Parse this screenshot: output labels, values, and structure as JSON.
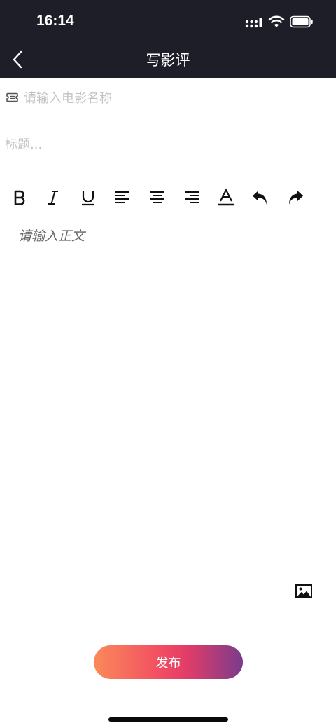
{
  "status_bar": {
    "time": "16:14"
  },
  "nav": {
    "title": "写影评"
  },
  "form": {
    "movie_placeholder": "请输入电影名称",
    "title_placeholder": "标题...",
    "body_placeholder": "请输入正文"
  },
  "toolbar": {
    "items": [
      {
        "name": "bold",
        "icon": "bold-icon"
      },
      {
        "name": "italic",
        "icon": "italic-icon"
      },
      {
        "name": "underline",
        "icon": "underline-icon"
      },
      {
        "name": "align-left",
        "icon": "align-left-icon"
      },
      {
        "name": "align-center",
        "icon": "align-center-icon"
      },
      {
        "name": "align-right",
        "icon": "align-right-icon"
      },
      {
        "name": "text-color",
        "icon": "text-color-icon"
      },
      {
        "name": "undo",
        "icon": "undo-icon"
      },
      {
        "name": "redo",
        "icon": "redo-icon"
      }
    ]
  },
  "bottom": {
    "publish_label": "发布"
  },
  "colors": {
    "header_bg": "#1e1e28",
    "placeholder": "#c2c2c6",
    "publish_gradient": [
      "#fa8a5a",
      "#f24d62",
      "#7a3b8c"
    ]
  }
}
